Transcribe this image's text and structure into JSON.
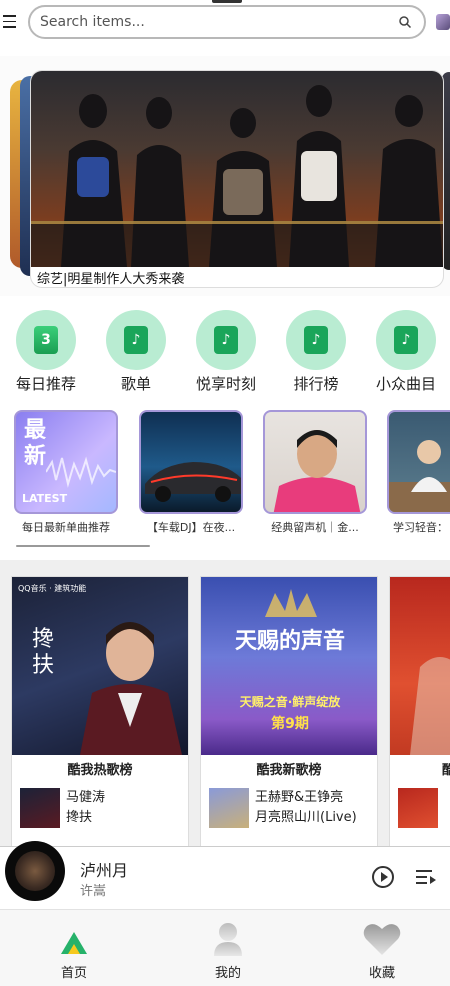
{
  "search": {
    "placeholder": "Search items..."
  },
  "banner": {
    "caption": "综艺|明星制作人大秀来袭"
  },
  "categories": [
    {
      "label": "每日推荐",
      "tile_text": "3",
      "icon": "calendar-icon"
    },
    {
      "label": "歌单",
      "tile_text": "♪",
      "icon": "music-note-icon"
    },
    {
      "label": "悦享时刻",
      "tile_text": "♪",
      "icon": "music-note-icon"
    },
    {
      "label": "排行榜",
      "tile_text": "♪",
      "icon": "music-note-icon"
    },
    {
      "label": "小众曲目",
      "tile_text": "♪",
      "icon": "music-note-icon"
    }
  ],
  "playlists": [
    {
      "title": "每日最新单曲推荐",
      "cover_text": "最新",
      "cover_sub": "LATEST"
    },
    {
      "title": "【车载DJ】在夜..."
    },
    {
      "title": "经典留声机｜金..."
    },
    {
      "title": "学习轻音："
    }
  ],
  "rank_cards": [
    {
      "title": "酷我热歌榜",
      "artist": "马健涛",
      "song": "搀扶",
      "cover_text": "搀扶",
      "cover_brand": "QQ音乐 · 建筑功能"
    },
    {
      "title": "酷我新歌榜",
      "artist": "王赫野&王铮亮",
      "song": "月亮照山川(Live)",
      "cover_text": "天赐的声音",
      "cover_sub": "天赐之音·鲜声绽放",
      "cover_sub2": "第9期"
    },
    {
      "title": "酷",
      "artist": "",
      "song": ""
    }
  ],
  "player": {
    "song": "泸州月",
    "artist": "许嵩"
  },
  "nav": [
    {
      "label": "首页",
      "icon": "home-icon"
    },
    {
      "label": "我的",
      "icon": "user-icon"
    },
    {
      "label": "收藏",
      "icon": "heart-icon"
    }
  ],
  "colors": {
    "accent_green": "#1aa55a",
    "category_circle": "#b9ecd2",
    "playlist_border": "#a597d8"
  }
}
